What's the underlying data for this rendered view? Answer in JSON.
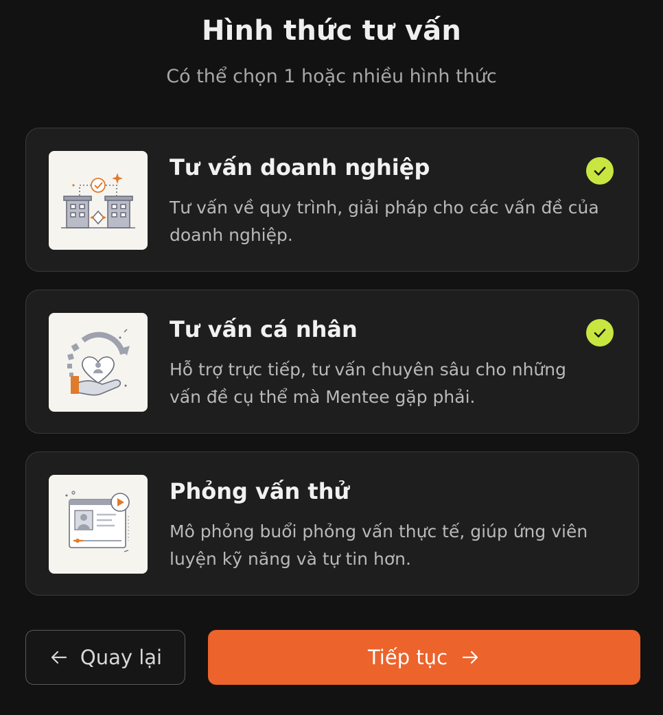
{
  "header": {
    "title": "Hình thức tư vấn",
    "subtitle": "Có thể chọn 1 hoặc nhiều hình thức"
  },
  "options": [
    {
      "title": "Tư vấn doanh nghiệp",
      "description": "Tư vấn về quy trình, giải pháp cho các vấn đề của doanh nghiệp.",
      "icon": "business-consulting-icon",
      "selected": true
    },
    {
      "title": "Tư vấn cá nhân",
      "description": "Hỗ trợ trực tiếp, tư vấn chuyên sâu cho những vấn đề cụ thể mà Mentee gặp phải.",
      "icon": "personal-care-icon",
      "selected": true
    },
    {
      "title": "Phỏng vấn thử",
      "description": "Mô phỏng buổi phỏng vấn thực tế, giúp ứng viên luyện kỹ năng và tự tin hơn.",
      "icon": "video-interview-icon",
      "selected": false
    }
  ],
  "actions": {
    "back_label": "Quay lại",
    "next_label": "Tiếp tục"
  },
  "colors": {
    "background": "#121212",
    "card": "#1e1e1e",
    "check": "#c8e640",
    "primary": "#ec632c",
    "illustration_accent": "#e07a2c"
  }
}
